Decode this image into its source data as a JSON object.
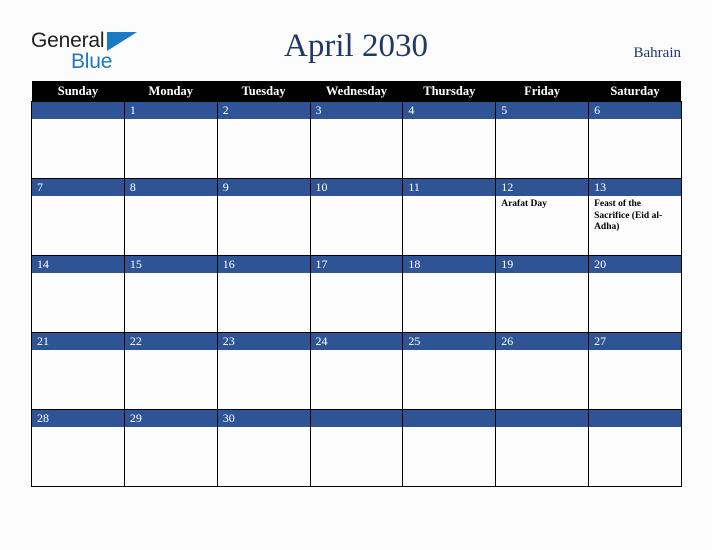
{
  "brand": {
    "name_part1": "General",
    "name_part2": "Blue",
    "triangle_icon": "blue-triangle-icon",
    "accent_blue": "#1b7ac4",
    "text_dark": "#231f20"
  },
  "header": {
    "title": "April 2030",
    "region": "Bahrain",
    "title_color": "#1f3864"
  },
  "calendar": {
    "header_bg": "#000000",
    "daybar_bg": "#2e5496",
    "weekday_headers": [
      "Sunday",
      "Monday",
      "Tuesday",
      "Wednesday",
      "Thursday",
      "Friday",
      "Saturday"
    ],
    "weeks": [
      [
        {
          "day": "",
          "events": []
        },
        {
          "day": "1",
          "events": []
        },
        {
          "day": "2",
          "events": []
        },
        {
          "day": "3",
          "events": []
        },
        {
          "day": "4",
          "events": []
        },
        {
          "day": "5",
          "events": []
        },
        {
          "day": "6",
          "events": []
        }
      ],
      [
        {
          "day": "7",
          "events": []
        },
        {
          "day": "8",
          "events": []
        },
        {
          "day": "9",
          "events": []
        },
        {
          "day": "10",
          "events": []
        },
        {
          "day": "11",
          "events": []
        },
        {
          "day": "12",
          "events": [
            "Arafat Day"
          ]
        },
        {
          "day": "13",
          "events": [
            "Feast of the Sacrifice (Eid al-Adha)"
          ]
        }
      ],
      [
        {
          "day": "14",
          "events": []
        },
        {
          "day": "15",
          "events": []
        },
        {
          "day": "16",
          "events": []
        },
        {
          "day": "17",
          "events": []
        },
        {
          "day": "18",
          "events": []
        },
        {
          "day": "19",
          "events": []
        },
        {
          "day": "20",
          "events": []
        }
      ],
      [
        {
          "day": "21",
          "events": []
        },
        {
          "day": "22",
          "events": []
        },
        {
          "day": "23",
          "events": []
        },
        {
          "day": "24",
          "events": []
        },
        {
          "day": "25",
          "events": []
        },
        {
          "day": "26",
          "events": []
        },
        {
          "day": "27",
          "events": []
        }
      ],
      [
        {
          "day": "28",
          "events": []
        },
        {
          "day": "29",
          "events": []
        },
        {
          "day": "30",
          "events": []
        },
        {
          "day": "",
          "events": []
        },
        {
          "day": "",
          "events": []
        },
        {
          "day": "",
          "events": []
        },
        {
          "day": "",
          "events": []
        }
      ]
    ]
  }
}
